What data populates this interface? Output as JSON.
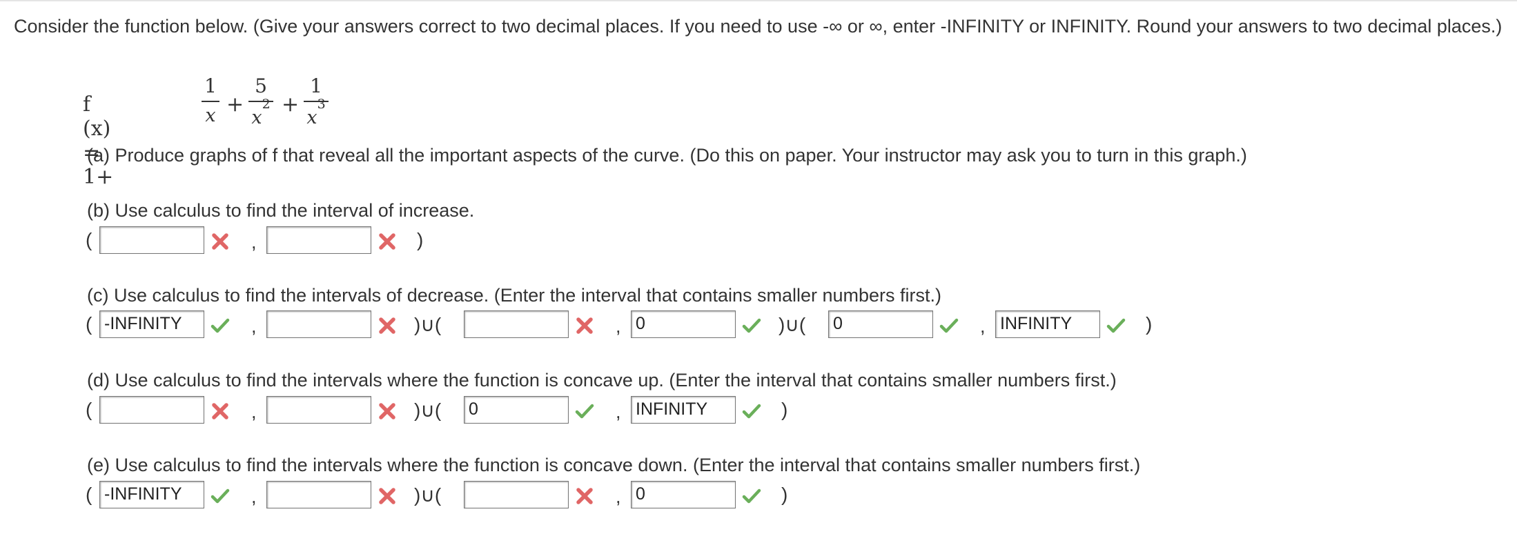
{
  "intro": "Consider the function below. (Give your answers correct to two decimal places. If you need to use -∞ or ∞, enter -INFINITY or INFINITY. Round your answers to two decimal places.)",
  "formula": {
    "lhs": "f (x) = 1+",
    "plus": "+",
    "one": "1",
    "five": "5",
    "x": "x",
    "p2": "2",
    "p3": "3"
  },
  "questions": {
    "a": "(a) Produce graphs of f that reveal all the important aspects of the curve. (Do this on paper. Your instructor may ask you to turn in this graph.)",
    "b": "(b) Use calculus to find the interval of increase.",
    "c": "(c) Use calculus to find the intervals of decrease. (Enter the interval that contains smaller numbers first.)",
    "d": "(d) Use calculus to find the intervals where the function is concave up. (Enter the interval that contains smaller numbers first.)",
    "e": "(e) Use calculus to find the intervals where the function is concave down. (Enter the interval that contains smaller numbers first.)"
  },
  "symbols": {
    "open": "(",
    "close": ")",
    "comma": ",",
    "union": ")∪("
  },
  "answers": {
    "b": [
      {
        "value": "",
        "status": "incorrect"
      },
      {
        "value": "",
        "status": "incorrect"
      }
    ],
    "c": [
      {
        "value": "-INFINITY",
        "status": "correct"
      },
      {
        "value": "",
        "status": "incorrect"
      },
      {
        "value": "",
        "status": "incorrect"
      },
      {
        "value": "0",
        "status": "correct"
      },
      {
        "value": "0",
        "status": "correct"
      },
      {
        "value": "INFINITY",
        "status": "correct"
      }
    ],
    "d": [
      {
        "value": "",
        "status": "incorrect"
      },
      {
        "value": "",
        "status": "incorrect"
      },
      {
        "value": "0",
        "status": "correct"
      },
      {
        "value": "INFINITY",
        "status": "correct"
      }
    ],
    "e": [
      {
        "value": "-INFINITY",
        "status": "correct"
      },
      {
        "value": "",
        "status": "incorrect"
      },
      {
        "value": "",
        "status": "incorrect"
      },
      {
        "value": "0",
        "status": "correct"
      }
    ]
  },
  "icons": {
    "correct": "check-icon",
    "incorrect": "cross-icon"
  },
  "colors": {
    "correct": "#6aaf5a",
    "incorrect": "#e06666",
    "text": "#333333"
  }
}
